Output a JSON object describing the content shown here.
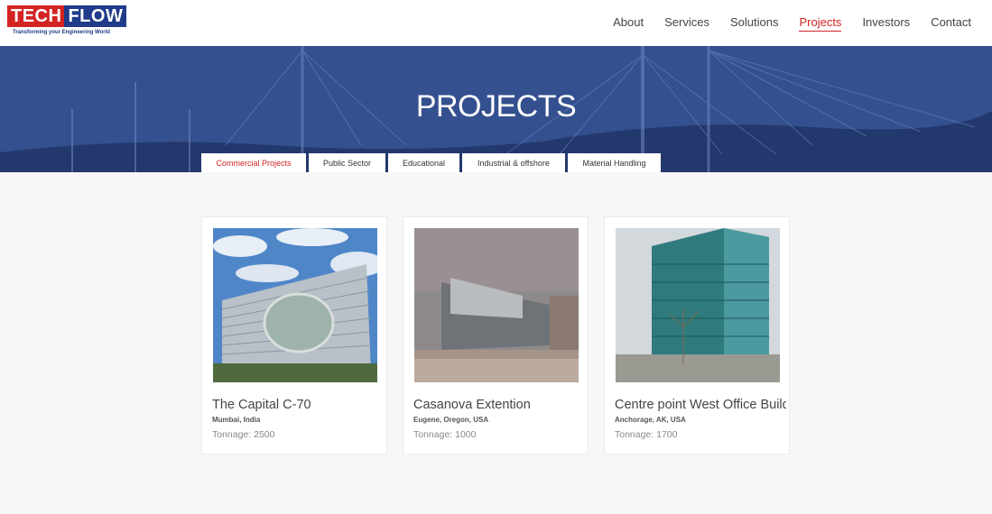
{
  "header": {
    "logo": {
      "part1": "TECH",
      "part2": "FLOW",
      "tagline": "Transforming your Engineering World"
    },
    "nav": [
      {
        "label": "About",
        "active": false
      },
      {
        "label": "Services",
        "active": false
      },
      {
        "label": "Solutions",
        "active": false
      },
      {
        "label": "Projects",
        "active": true
      },
      {
        "label": "Investors",
        "active": false
      },
      {
        "label": "Contact",
        "active": false
      }
    ]
  },
  "hero": {
    "title": "PROJECTS"
  },
  "tabs": [
    {
      "label": "Commercial Projects",
      "active": true
    },
    {
      "label": "Public Sector",
      "active": false
    },
    {
      "label": "Educational",
      "active": false
    },
    {
      "label": "Industrial & offshore",
      "active": false
    },
    {
      "label": "Material Handling",
      "active": false
    }
  ],
  "projects": [
    {
      "title": "The Capital C-70",
      "location": "Mumbai, India",
      "tonnage": "Tonnage: 2500"
    },
    {
      "title": "Casanova Extention",
      "location": "Eugene, Oregon, USA",
      "tonnage": "Tonnage: 1000"
    },
    {
      "title": "Centre point West Office Building",
      "location": "Anchorage, AK, USA",
      "tonnage": "Tonnage: 1700"
    }
  ],
  "colors": {
    "brand_red": "#d32323",
    "brand_blue": "#1f3b8a",
    "hero_blue": "#2e4a8f"
  }
}
